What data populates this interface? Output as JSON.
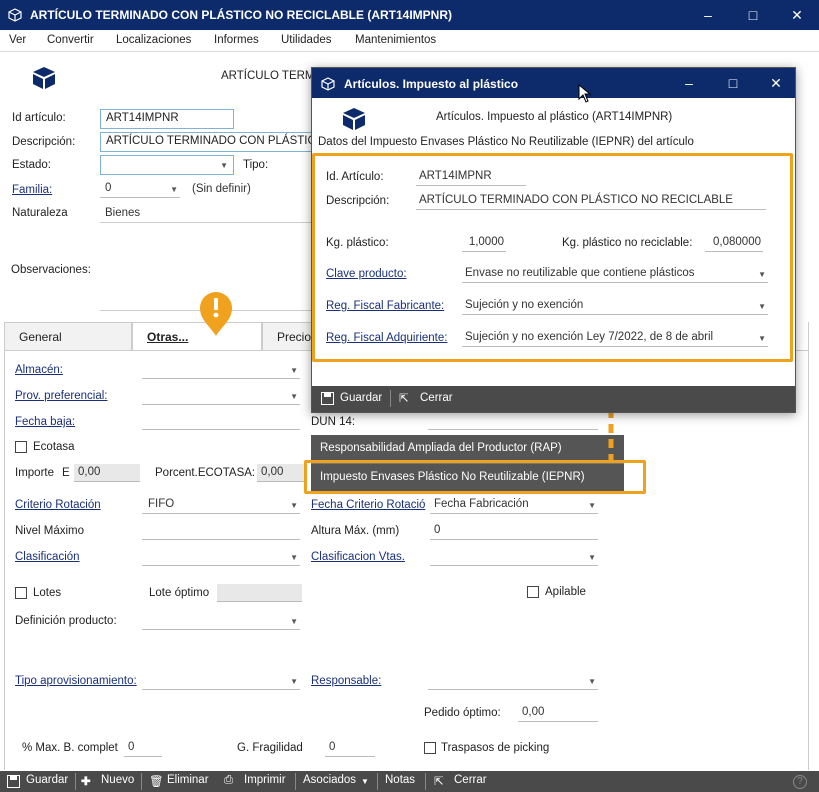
{
  "window": {
    "title": "ARTÍCULO TERMINADO CON PLÁSTICO NO RECICLABLE (ART14IMPNR)"
  },
  "menu": [
    "Ver",
    "Convertir",
    "Localizaciones",
    "Informes",
    "Utilidades",
    "Mantenimientos"
  ],
  "header": {
    "title_partial": "ARTÍCULO TERMI",
    "id_label": "Id artículo:",
    "id_value": "ART14IMPNR",
    "desc_label": "Descripción:",
    "desc_value": "ARTÍCULO TERMINADO CON PLÁSTICO",
    "estado_label": "Estado:",
    "tipo_label": "Tipo:",
    "familia_label": "Familia:",
    "familia_value": "0",
    "familia_desc": "(Sin definir)",
    "naturaleza_label": "Naturaleza",
    "naturaleza_value": "Bienes",
    "observaciones_label": "Observaciones:"
  },
  "tabs": [
    "General",
    "Otras...",
    "Precios"
  ],
  "otras": {
    "almacen": "Almacén:",
    "prov_preferencial": "Prov. preferencial:",
    "fecha_baja": "Fecha baja:",
    "dun14": "DUN 14:",
    "ecotasa": "Ecotasa",
    "importe_label": "Importe",
    "importe_e": "E",
    "importe_value": "0,00",
    "porcent_label": "Porcent.ECOTASA:",
    "porcent_value": "0,00",
    "criterio_rotacion": "Criterio Rotación",
    "criterio_rotacion_value": "FIFO",
    "fecha_criterio": "Fecha Criterio Rotació",
    "fecha_criterio_value": "Fecha Fabricación",
    "nivel_maximo": "Nivel Máximo",
    "altura_max": "Altura Máx. (mm)",
    "altura_max_value": "0",
    "clasificacion": "Clasificación",
    "clasificacion_vtas": "Clasificacion Vtas.",
    "lotes": "Lotes",
    "lote_optimo": "Lote óptimo",
    "apilable": "Apilable",
    "definicion_producto": "Definición producto:",
    "tipo_aprov": "Tipo aprovisionamiento:",
    "responsable": "Responsable:",
    "pedido_optimo": "Pedido óptimo:",
    "pedido_optimo_value": "0,00",
    "max_b_complet": "% Max. B. complet",
    "max_b_complet_value": "0",
    "g_fragilidad": "G. Fragilidad",
    "g_fragilidad_value": "0",
    "traspasos_picking": "Traspasos de picking"
  },
  "bottombar": [
    "Guardar",
    "Nuevo",
    "Eliminar",
    "Imprimir",
    "Asociados",
    "Notas",
    "Cerrar"
  ],
  "context_menu": [
    "Responsabilidad Ampliada del Productor (RAP)",
    "Impuesto Envases Plástico No Reutilizable (IEPNR)"
  ],
  "dialog": {
    "title": "Artículos. Impuesto al plástico",
    "header": "Artículos. Impuesto al plástico (ART14IMPNR)",
    "subtitle": "Datos del Impuesto Envases Plástico No Reutilizable (IEPNR) del artículo",
    "id_label": "Id. Artículo:",
    "id_value": "ART14IMPNR",
    "desc_label": "Descripción:",
    "desc_value": "ARTÍCULO TERMINADO CON PLÁSTICO NO RECICLABLE",
    "kg_label": "Kg. plástico:",
    "kg_value": "1,0000",
    "kg_norec_label": "Kg. plástico no reciclable:",
    "kg_norec_value": "0,080000",
    "clave_label": "Clave producto:",
    "clave_value": "Envase no reutilizable que contiene plásticos",
    "fab_label": "Reg. Fiscal Fabricante:",
    "fab_value": "Sujeción y no exención",
    "adq_label": "Reg. Fiscal Adquiriente:",
    "adq_value": "Sujeción y no exención Ley 7/2022, de 8 de abril",
    "save": "Guardar",
    "close": "Cerrar"
  },
  "colors": {
    "titlebar": "#0d2a6b",
    "highlight": "#f0a11e",
    "toolbar": "#4a4a4a",
    "link": "#1a2f7a"
  }
}
